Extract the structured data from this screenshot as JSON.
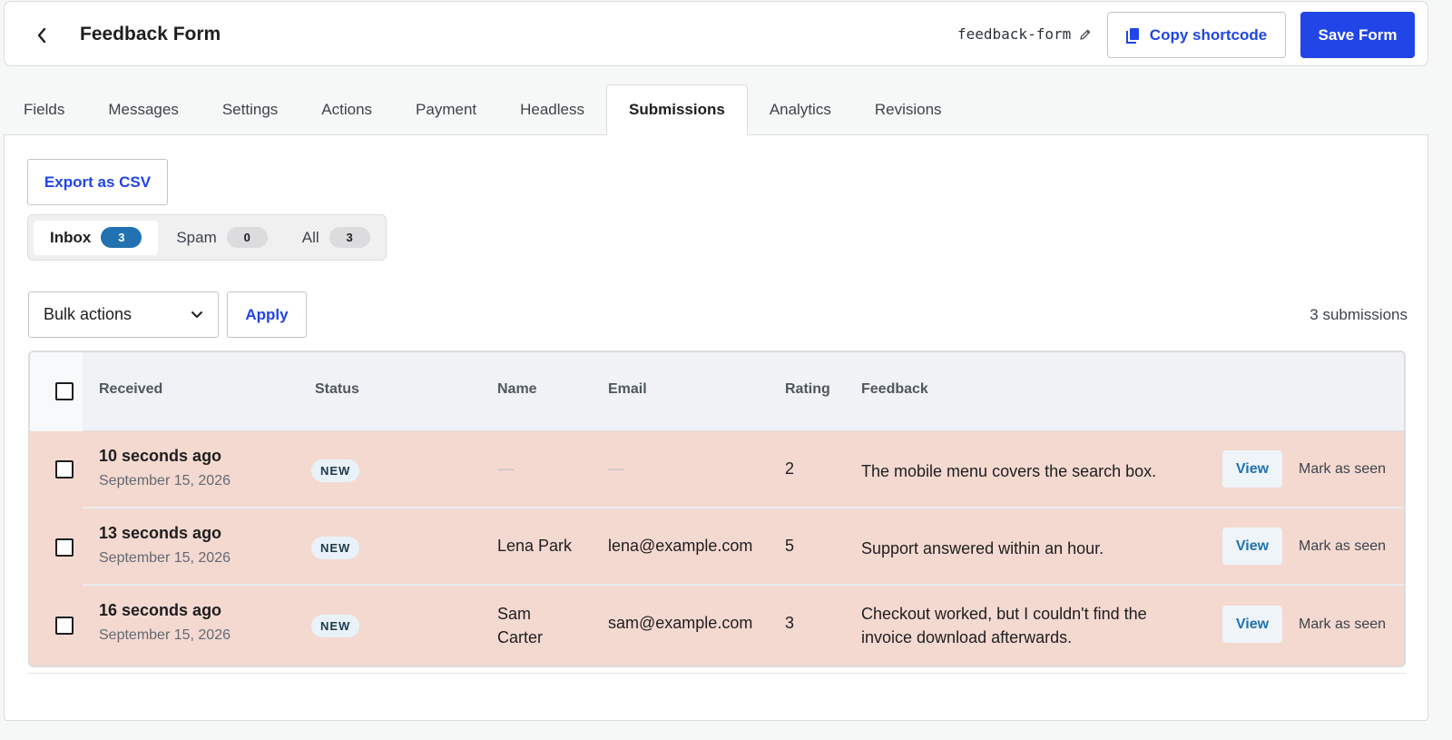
{
  "header": {
    "title": "Feedback Form",
    "slug": "feedback-form",
    "copy_label": "Copy shortcode",
    "save_label": "Save Form"
  },
  "tabs": [
    {
      "label": "Fields"
    },
    {
      "label": "Messages"
    },
    {
      "label": "Settings"
    },
    {
      "label": "Actions"
    },
    {
      "label": "Payment"
    },
    {
      "label": "Headless"
    },
    {
      "label": "Submissions",
      "active": true
    },
    {
      "label": "Analytics"
    },
    {
      "label": "Revisions"
    }
  ],
  "toolbar": {
    "export_label": "Export as CSV",
    "bulk_label": "Bulk actions",
    "apply_label": "Apply",
    "submission_count": "3 submissions"
  },
  "filters": [
    {
      "label": "Inbox",
      "count": "3",
      "active": true
    },
    {
      "label": "Spam",
      "count": "0"
    },
    {
      "label": "All",
      "count": "3"
    }
  ],
  "table": {
    "columns": [
      "Received",
      "Status",
      "Name",
      "Email",
      "Rating",
      "Feedback"
    ],
    "rows": [
      {
        "received": "10 seconds ago",
        "date": "September 15, 2026",
        "status": "NEW",
        "name": "—",
        "email": "—",
        "rating": "2",
        "feedback": "The mobile menu covers the search box.",
        "view": "View",
        "seen": "Mark as seen"
      },
      {
        "received": "13 seconds ago",
        "date": "September 15, 2026",
        "status": "NEW",
        "name": "Lena Park",
        "email": "lena@example.com",
        "rating": "5",
        "feedback": "Support answered within an hour.",
        "view": "View",
        "seen": "Mark as seen"
      },
      {
        "received": "16 seconds ago",
        "date": "September 15, 2026",
        "status": "NEW",
        "name": "Sam Carter",
        "email": "sam@example.com",
        "rating": "3",
        "feedback": "Checkout worked, but I couldn't find the invoice download afterwards.",
        "view": "View",
        "seen": "Mark as seen"
      }
    ]
  },
  "colors": {
    "accent": "#2145e6",
    "unread_row": "#f4d9d1",
    "inbox_badge": "#2271b1"
  }
}
